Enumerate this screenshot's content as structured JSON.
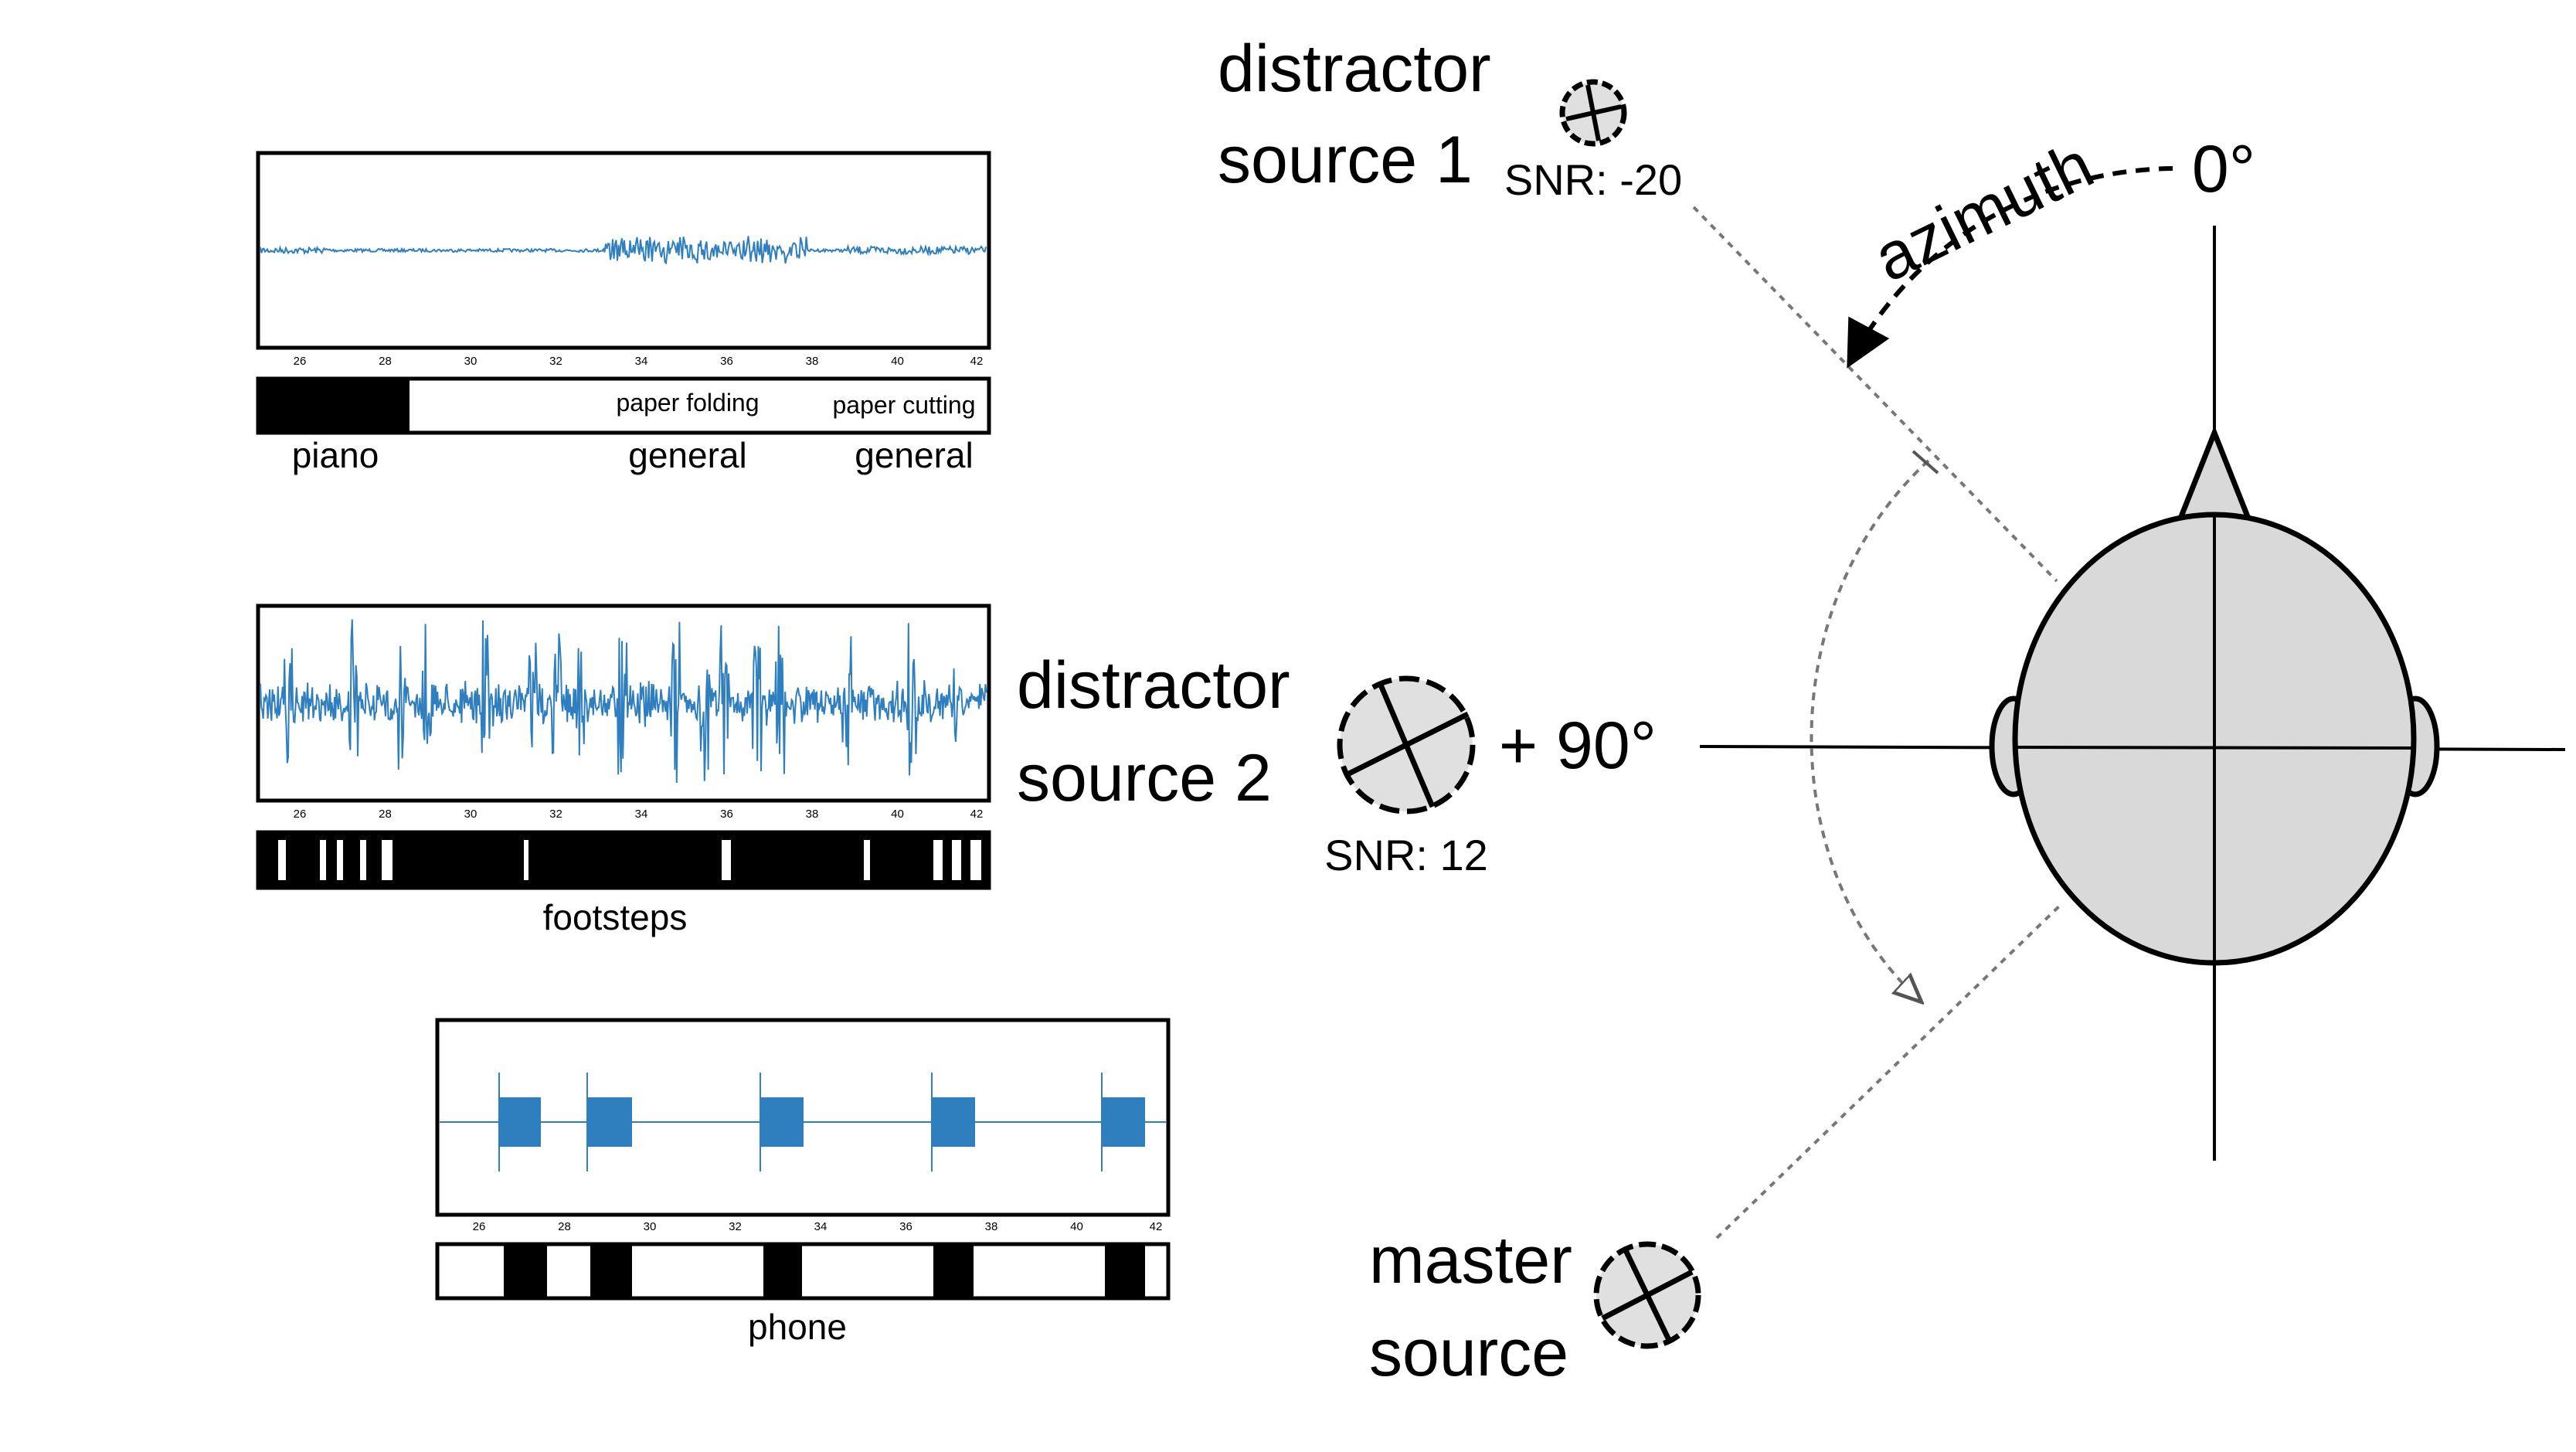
{
  "colors": {
    "waveform": "#2f7fbf",
    "head_fill": "#d9d9d9",
    "source_fill": "#e0e0e0",
    "ink": "#000000",
    "guide": "#777777"
  },
  "icons": [
    "loudspeaker-source-icon",
    "listener-head-icon",
    "arrow-icon"
  ],
  "diagram": {
    "azimuth_label": "azimuth",
    "angle_0": "0°",
    "angle_90": "+ 90°",
    "sources": [
      {
        "id": "distractor1",
        "line1": "distractor",
        "line2": "source 1",
        "snr": "SNR: -20"
      },
      {
        "id": "distractor2",
        "line1": "distractor",
        "line2": "source 2",
        "snr": "SNR: 12"
      },
      {
        "id": "master",
        "line1": "master",
        "line2": "source",
        "snr": ""
      }
    ]
  },
  "panels": [
    {
      "id": "piano-paper",
      "amplitude": "quiet",
      "ticks": [
        "26",
        "28",
        "30",
        "32",
        "34",
        "36",
        "38",
        "40",
        "42"
      ],
      "labels_above": [
        "paper folding",
        "paper cutting"
      ],
      "labels_below": [
        "piano",
        "general",
        "general"
      ],
      "caption": ""
    },
    {
      "id": "footsteps",
      "amplitude": "impulsive",
      "ticks": [
        "26",
        "28",
        "30",
        "32",
        "34",
        "36",
        "38",
        "40",
        "42"
      ],
      "labels_above": [],
      "labels_below": [],
      "caption": "footsteps"
    },
    {
      "id": "phone",
      "amplitude": "bursts",
      "ticks": [
        "26",
        "28",
        "30",
        "32",
        "34",
        "36",
        "38",
        "40",
        "42"
      ],
      "labels_above": [],
      "labels_below": [],
      "caption": "phone"
    }
  ]
}
